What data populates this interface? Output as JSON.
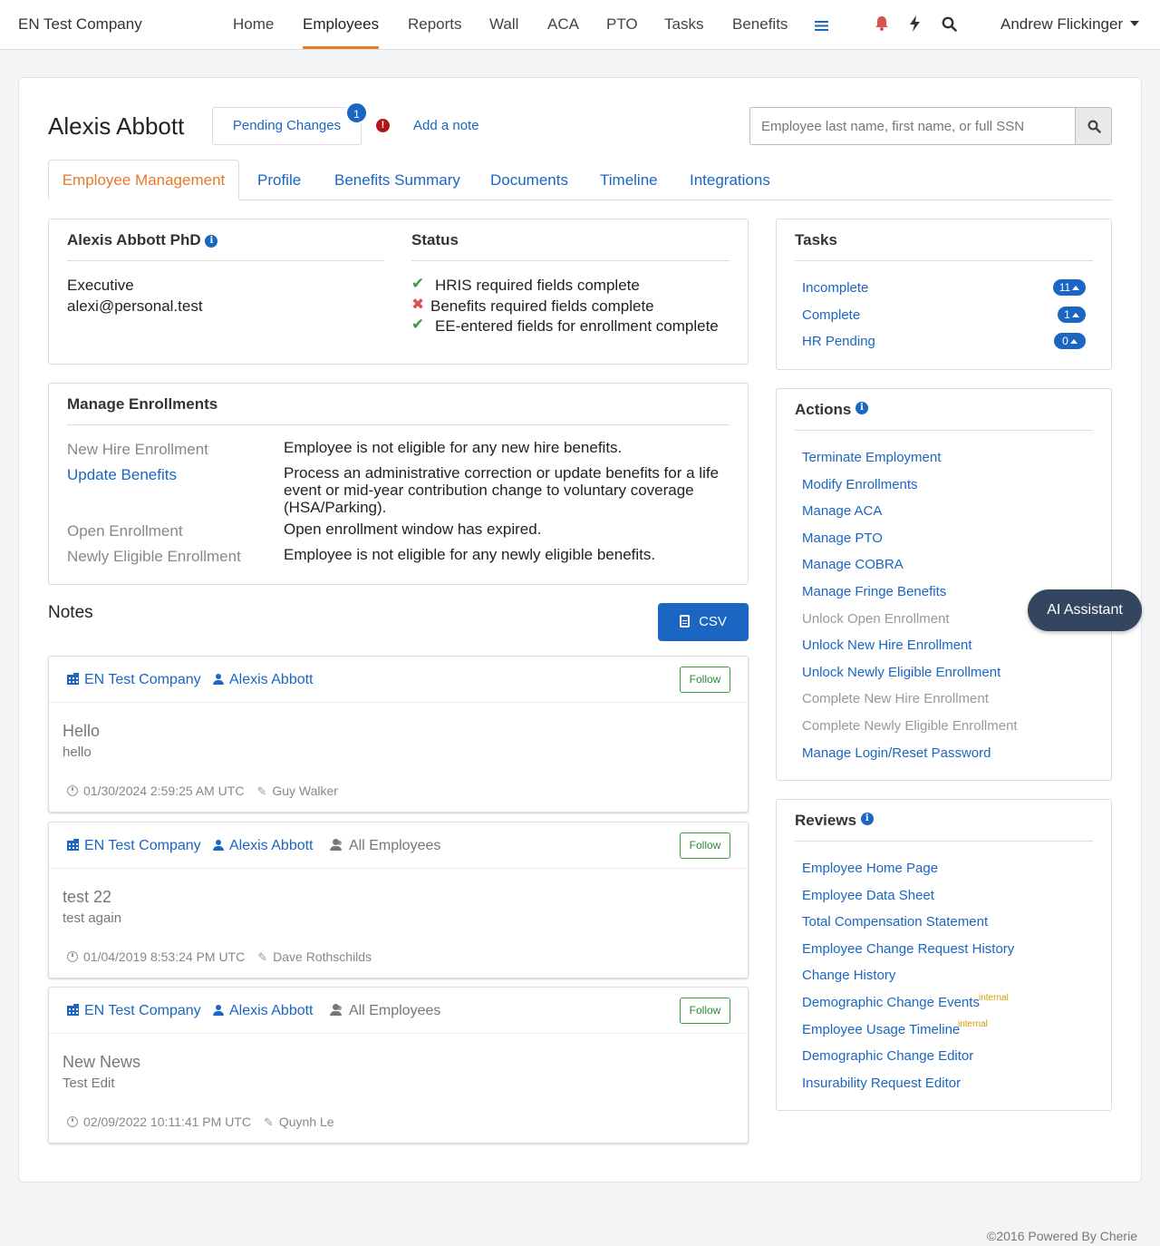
{
  "nav": {
    "brand": "EN Test Company",
    "items": [
      "Home",
      "Employees",
      "Reports",
      "Wall",
      "ACA",
      "PTO",
      "Tasks",
      "Benefits"
    ],
    "active": "Employees",
    "user": "Andrew Flickinger"
  },
  "header": {
    "employee_name": "Alexis Abbott",
    "pending_changes_label": "Pending Changes",
    "pending_count": "1",
    "add_note_label": "Add a note",
    "search_placeholder": "Employee last name, first name, or full SSN"
  },
  "tabs": [
    "Employee Management",
    "Profile",
    "Benefits Summary",
    "Documents",
    "Timeline",
    "Integrations"
  ],
  "employee_card": {
    "full_name": "Alexis Abbott PhD",
    "title": "Executive",
    "email": "alexi@personal.test"
  },
  "status": {
    "heading": "Status",
    "items": [
      {
        "label": "HRIS required fields complete",
        "ok": true
      },
      {
        "label": "Benefits required fields complete",
        "ok": false
      },
      {
        "label": "EE-entered fields for enrollment complete",
        "ok": true
      }
    ]
  },
  "enrollments": {
    "heading": "Manage Enrollments",
    "rows": [
      {
        "label": "New Hire Enrollment",
        "link": false,
        "desc": "Employee is not eligible for any new hire benefits."
      },
      {
        "label": "Update Benefits",
        "link": true,
        "desc": "Process an administrative correction or update benefits for a life event or mid-year contribution change to voluntary coverage (HSA/Parking)."
      },
      {
        "label": "Open Enrollment",
        "link": false,
        "desc": "Open enrollment window has expired."
      },
      {
        "label": "Newly Eligible Enrollment",
        "link": false,
        "desc": "Employee is not eligible for any newly eligible benefits."
      }
    ]
  },
  "tasks": {
    "heading": "Tasks",
    "items": [
      {
        "label": "Incomplete",
        "count": "11"
      },
      {
        "label": "Complete",
        "count": "1"
      },
      {
        "label": "HR Pending",
        "count": "0"
      }
    ]
  },
  "actions": {
    "heading": "Actions",
    "items": [
      {
        "label": "Terminate Employment",
        "enabled": true
      },
      {
        "label": "Modify Enrollments",
        "enabled": true
      },
      {
        "label": "Manage ACA",
        "enabled": true
      },
      {
        "label": "Manage PTO",
        "enabled": true
      },
      {
        "label": "Manage COBRA",
        "enabled": true
      },
      {
        "label": "Manage Fringe Benefits",
        "enabled": true
      },
      {
        "label": "Unlock Open Enrollment",
        "enabled": false
      },
      {
        "label": "Unlock New Hire Enrollment",
        "enabled": true
      },
      {
        "label": "Unlock Newly Eligible Enrollment",
        "enabled": true
      },
      {
        "label": "Complete New Hire Enrollment",
        "enabled": false
      },
      {
        "label": "Complete Newly Eligible Enrollment",
        "enabled": false
      },
      {
        "label": "Manage Login/Reset Password",
        "enabled": true
      }
    ]
  },
  "reviews": {
    "heading": "Reviews",
    "internal_label": "internal",
    "items": [
      {
        "label": "Employee Home Page",
        "internal": false
      },
      {
        "label": "Employee Data Sheet",
        "internal": false
      },
      {
        "label": "Total Compensation Statement",
        "internal": false
      },
      {
        "label": "Employee Change Request History",
        "internal": false
      },
      {
        "label": "Change History",
        "internal": false
      },
      {
        "label": "Demographic Change Events",
        "internal": true
      },
      {
        "label": "Employee Usage Timeline",
        "internal": true
      },
      {
        "label": "Demographic Change Editor",
        "internal": false
      },
      {
        "label": "Insurability Request Editor",
        "internal": false
      }
    ]
  },
  "notes": {
    "heading": "Notes",
    "csv_label": "CSV",
    "follow_label": "Follow",
    "items": [
      {
        "company": "EN Test Company",
        "employee": "Alexis Abbott",
        "audience": "",
        "title": "Hello",
        "body": "hello",
        "timestamp": "01/30/2024 2:59:25 AM UTC",
        "author": "Guy Walker"
      },
      {
        "company": "EN Test Company",
        "employee": "Alexis Abbott",
        "audience": "All Employees",
        "title": "test 22",
        "body": "test again",
        "timestamp": "01/04/2019 8:53:24 PM UTC",
        "author": "Dave Rothschilds"
      },
      {
        "company": "EN Test Company",
        "employee": "Alexis Abbott",
        "audience": "All Employees",
        "title": "New News",
        "body": "Test Edit",
        "timestamp": "02/09/2022 10:11:41 PM UTC",
        "author": "Quynh Le"
      }
    ]
  },
  "ai_assistant_label": "AI Assistant",
  "footer": "©2016 Powered By Cherie",
  "colors": {
    "accent": "#1a66c2",
    "active_tab": "#e8792b",
    "success": "#3a9b45",
    "danger": "#d9534f"
  }
}
